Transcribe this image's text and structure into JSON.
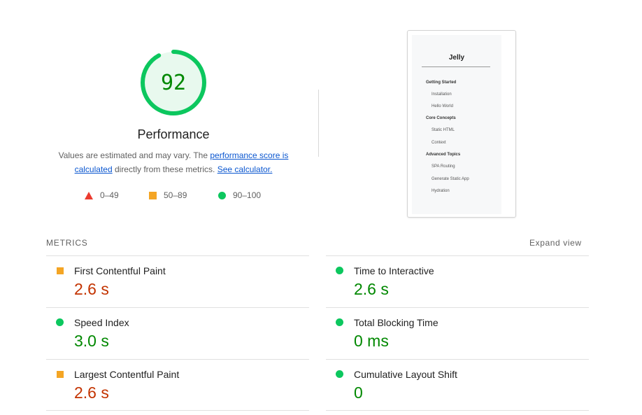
{
  "score": {
    "value": "92",
    "fraction": 0.92,
    "label": "Performance",
    "arc_color": "#0cc75e",
    "fill_color": "#e8f9ee",
    "text_color": "#008800"
  },
  "description": {
    "part1": "Values are estimated and may vary. The ",
    "link1": "performance score is calculated",
    "part2": " directly from these metrics. ",
    "link2": "See calculator."
  },
  "legend": [
    {
      "shape": "triangle",
      "range": "0–49",
      "color": "#eb3b2f"
    },
    {
      "shape": "square",
      "range": "50–89",
      "color": "#f4a524"
    },
    {
      "shape": "circle",
      "range": "90–100",
      "color": "#0cc75e"
    }
  ],
  "thumbnail": {
    "title": "Jelly",
    "items": [
      {
        "text": "Getting Started",
        "section": true
      },
      {
        "text": "Installation",
        "section": false
      },
      {
        "text": "Hello World",
        "section": false
      },
      {
        "text": "Core Concepts",
        "section": true
      },
      {
        "text": "Static HTML",
        "section": false
      },
      {
        "text": "Context",
        "section": false
      },
      {
        "text": "Advanced Topics",
        "section": true
      },
      {
        "text": "SPA Routing",
        "section": false
      },
      {
        "text": "Generate Static App",
        "section": false
      },
      {
        "text": "Hydration",
        "section": false
      }
    ]
  },
  "metrics": {
    "header": "METRICS",
    "expand": "Expand view",
    "left": [
      {
        "name": "First Contentful Paint",
        "value": "2.6 s",
        "status": "average"
      },
      {
        "name": "Speed Index",
        "value": "3.0 s",
        "status": "pass"
      },
      {
        "name": "Largest Contentful Paint",
        "value": "2.6 s",
        "status": "average"
      }
    ],
    "right": [
      {
        "name": "Time to Interactive",
        "value": "2.6 s",
        "status": "pass"
      },
      {
        "name": "Total Blocking Time",
        "value": "0 ms",
        "status": "pass"
      },
      {
        "name": "Cumulative Layout Shift",
        "value": "0",
        "status": "pass"
      }
    ]
  }
}
